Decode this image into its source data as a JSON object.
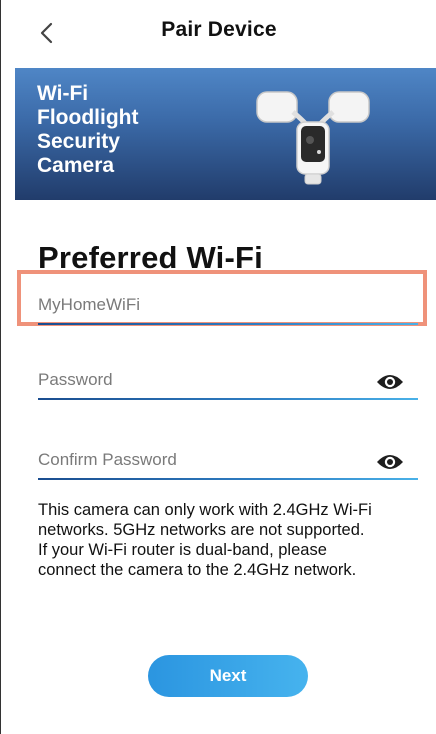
{
  "header": {
    "title": "Pair Device",
    "back_icon": "chevron-left-icon"
  },
  "banner": {
    "product_lines": [
      "Wi-Fi",
      "Floodlight",
      "Security",
      "Camera"
    ],
    "gradient_colors": [
      "#4f86c6",
      "#213c6b"
    ]
  },
  "form": {
    "heading": "Preferred Wi-Fi",
    "ssid_value": "MyHomeWiFi",
    "password_placeholder": "Password",
    "confirm_placeholder": "Confirm Password",
    "visibility_icon": "eye-icon"
  },
  "info": {
    "lines": [
      "This camera can only work with 2.4GHz Wi-Fi",
      "networks. 5GHz networks are not supported.",
      "If your Wi-Fi router is dual-band, please",
      "connect the camera to the 2.4GHz network."
    ]
  },
  "actions": {
    "next_label": "Next"
  },
  "colors": {
    "highlight": "#ef927a",
    "accent": "#2b95e0",
    "underline": "#1a4d8f"
  }
}
